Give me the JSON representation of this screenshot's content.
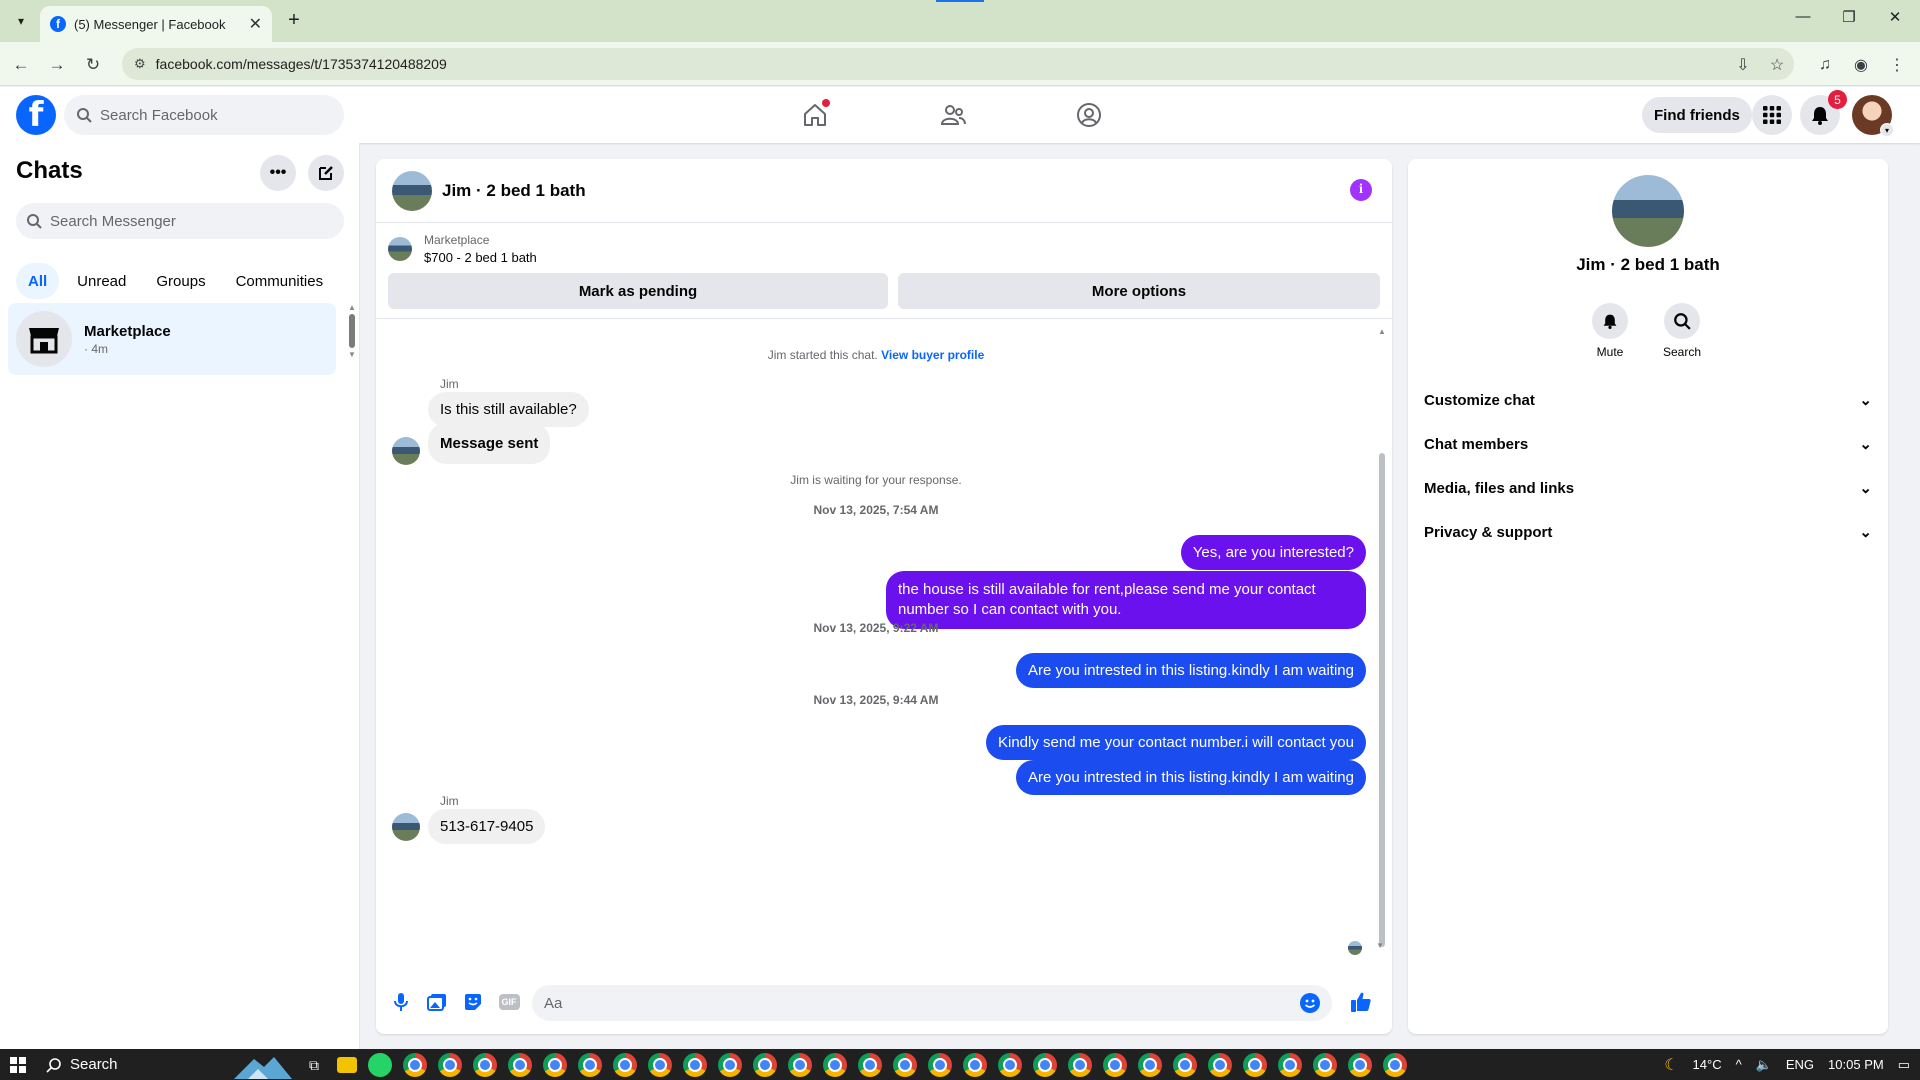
{
  "browser": {
    "tab_title": "(5) Messenger | Facebook",
    "url": "facebook.com/messages/t/1735374120488209"
  },
  "fb": {
    "search_placeholder": "Search Facebook",
    "find_friends": "Find friends",
    "notification_count": "5"
  },
  "chats": {
    "title": "Chats",
    "search_placeholder": "Search Messenger",
    "filters": [
      "All",
      "Unread",
      "Groups",
      "Communities"
    ],
    "items": [
      {
        "name": "Marketplace",
        "sub": "· 4m"
      }
    ]
  },
  "conversation": {
    "title": "Jim · 2 bed 1 bath",
    "marketplace_label": "Marketplace",
    "listing": "$700 - 2 bed 1 bath",
    "mark_pending": "Mark as pending",
    "more_options": "More options",
    "started_text": "Jim started this chat.",
    "view_buyer": "View buyer profile",
    "sender_name": "Jim",
    "msg_in_1": "Is this still available?",
    "msg_in_2": "Message sent",
    "waiting_text": "Jim is waiting for your response.",
    "ts_1": "Nov 13, 2025, 7:54 AM",
    "msg_out_1": "Yes, are you interested?",
    "msg_out_2": "the house is still available for rent,please send me your contact number so I can contact with you.",
    "ts_2": "Nov 13, 2025, 9:22 AM",
    "msg_out_3": "Are you intrested in this listing.kindly I am waiting",
    "ts_3": "Nov 13, 2025, 9:44 AM",
    "msg_out_4": "Kindly send me your contact number.i will contact you",
    "msg_out_5": "Are you intrested in this listing.kindly I am waiting",
    "msg_in_3": "513-617-9405",
    "composer_placeholder": "Aa",
    "gif_label": "GIF"
  },
  "info_panel": {
    "name": "Jim · 2 bed 1 bath",
    "mute": "Mute",
    "search": "Search",
    "sections": [
      "Customize chat",
      "Chat members",
      "Media, files and links",
      "Privacy & support"
    ]
  },
  "taskbar": {
    "search": "Search",
    "temp": "14°C",
    "lang": "ENG",
    "time": "10:05 PM"
  },
  "colors": {
    "fb_blue": "#0866ff",
    "outgoing_purple": "#6a11ee",
    "outgoing_blue": "#1a4cf0",
    "info_purple": "#a033ff"
  }
}
